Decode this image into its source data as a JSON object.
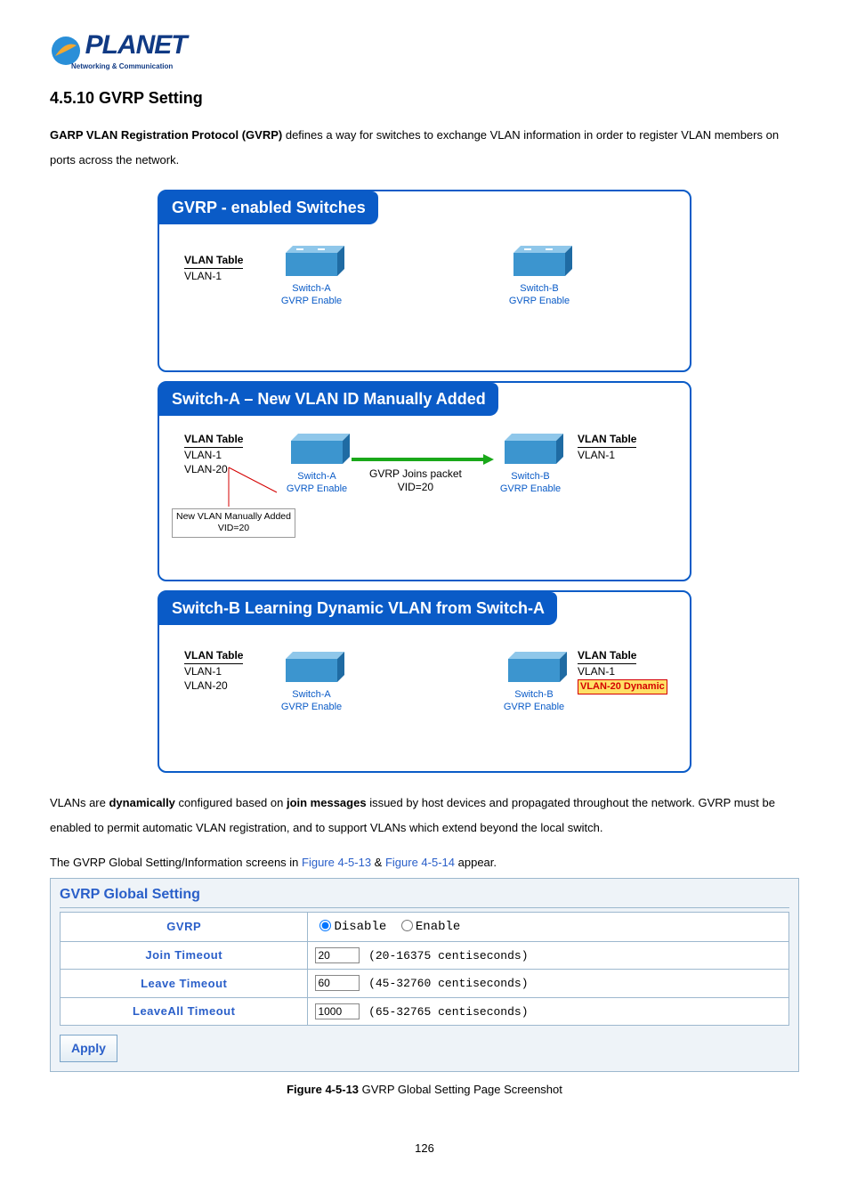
{
  "logo": {
    "brand": "PLANET",
    "tagline": "Networking & Communication"
  },
  "heading": "4.5.10 GVRP Setting",
  "intro": {
    "bold": "GARP VLAN Registration Protocol (GVRP)",
    "rest": " defines a way for switches to exchange VLAN information in order to register VLAN members on ports across the network."
  },
  "diagrams": {
    "d1": {
      "title": "GVRP - enabled Switches",
      "vlan_table_hdr": "VLAN Table",
      "vlan_a": "VLAN-1",
      "switch_a_name": "Switch-A",
      "switch_a_sub": "GVRP Enable",
      "switch_b_name": "Switch-B",
      "switch_b_sub": "GVRP Enable"
    },
    "d2": {
      "title": "Switch-A – New VLAN ID Manually Added",
      "vlan_table_hdr_a": "VLAN Table",
      "vlan_a_1": "VLAN-1",
      "vlan_a_2": "VLAN-20",
      "note_l1": "New VLAN Manually Added",
      "note_l2": "VID=20",
      "switch_a_name": "Switch-A",
      "switch_a_sub": "GVRP Enable",
      "mid_l1": "GVRP Joins packet",
      "mid_l2": "VID=20",
      "switch_b_name": "Switch-B",
      "switch_b_sub": "GVRP Enable",
      "vlan_table_hdr_b": "VLAN Table",
      "vlan_b_1": "VLAN-1"
    },
    "d3": {
      "title": "Switch-B Learning Dynamic VLAN from Switch-A",
      "vlan_table_hdr_a": "VLAN Table",
      "vlan_a_1": "VLAN-1",
      "vlan_a_2": "VLAN-20",
      "switch_a_name": "Switch-A",
      "switch_a_sub": "GVRP Enable",
      "switch_b_name": "Switch-B",
      "switch_b_sub": "GVRP Enable",
      "vlan_table_hdr_b": "VLAN Table",
      "vlan_b_1": "VLAN-1",
      "vlan_b_dyn": "VLAN-20 Dynamic"
    }
  },
  "para2": {
    "pre": "VLANs are ",
    "b1": "dynamically",
    "mid1": " configured based on ",
    "b2": "join messages",
    "post": " issued by host devices and propagated throughout the network. GVRP must be enabled to permit automatic VLAN registration, and to support VLANs which extend beyond the local switch."
  },
  "para3": {
    "pre": "The GVRP Global Setting/Information screens in ",
    "link1": "Figure 4-5-13",
    "amp": " & ",
    "link2": "Figure 4-5-14",
    "post": " appear."
  },
  "cfg": {
    "heading": "GVRP Global Setting",
    "rows": {
      "gvrp": {
        "label": "GVRP",
        "opt_disable": "Disable",
        "opt_enable": "Enable"
      },
      "join": {
        "label": "Join Timeout",
        "value": "20",
        "hint": "(20-16375 centiseconds)"
      },
      "leave": {
        "label": "Leave Timeout",
        "value": "60",
        "hint": "(45-32760 centiseconds)"
      },
      "leaveall": {
        "label": "LeaveAll Timeout",
        "value": "1000",
        "hint": "(65-32765 centiseconds)"
      }
    },
    "apply": "Apply"
  },
  "figure_caption": {
    "bold": "Figure 4-5-13",
    "rest": " GVRP Global Setting Page Screenshot"
  },
  "page_number": "126"
}
